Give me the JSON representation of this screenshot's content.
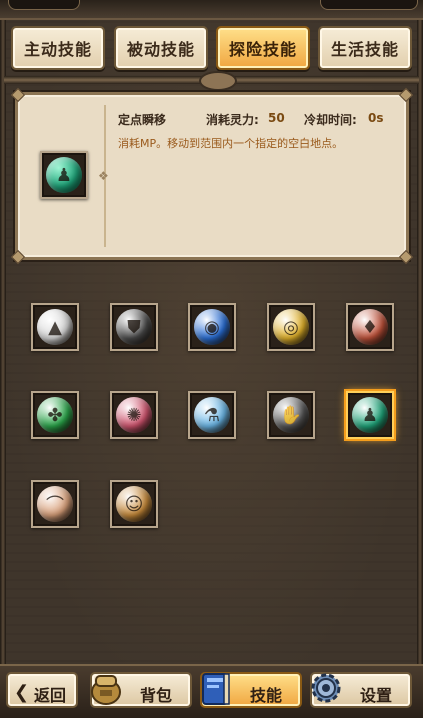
{
  "tabs": [
    {
      "label": "主动技能",
      "active": false
    },
    {
      "label": "被动技能",
      "active": false
    },
    {
      "label": "探险技能",
      "active": true
    },
    {
      "label": "生活技能",
      "active": false
    }
  ],
  "detail": {
    "skill_name": "定点瞬移",
    "mp_cost_label": "消耗灵力:",
    "mp_cost_value": "50",
    "cooldown_label": "冷却时间:",
    "cooldown_value": "0s",
    "description": "消耗MP。移动到范围内一个指定的空白地点。"
  },
  "skills": [
    {
      "icon": "teeth-trap-icon",
      "glyph": "▲",
      "color": "#d8d8d8"
    },
    {
      "icon": "shield-icon",
      "glyph": "⛊",
      "color": "#4a4a4a"
    },
    {
      "icon": "eye-icon",
      "glyph": "◉",
      "color": "#2a6fd6"
    },
    {
      "icon": "golden-eye-icon",
      "glyph": "◎",
      "color": "#e2b22a"
    },
    {
      "icon": "candle-icon",
      "glyph": "♦",
      "color": "#c0523a"
    },
    {
      "icon": "green-creature-icon",
      "glyph": "✤",
      "color": "#2aa64a"
    },
    {
      "icon": "gear-icon",
      "glyph": "✺",
      "color": "#d0546e"
    },
    {
      "icon": "potion-flask-icon",
      "glyph": "⚗",
      "color": "#6ab6e6"
    },
    {
      "icon": "hand-icon",
      "glyph": "✋",
      "color": "#555555"
    },
    {
      "icon": "teleport-figure-icon",
      "glyph": "♟",
      "color": "#1fa57a",
      "selected": true
    },
    {
      "icon": "scroll-icon",
      "glyph": "⌒",
      "color": "#d9a07a"
    },
    {
      "icon": "character-portrait-icon",
      "glyph": "☺",
      "color": "#c78a3a"
    }
  ],
  "bottom_nav": {
    "back_label": "返回",
    "bag_label": "背包",
    "skills_label": "技能",
    "settings_label": "设置"
  }
}
